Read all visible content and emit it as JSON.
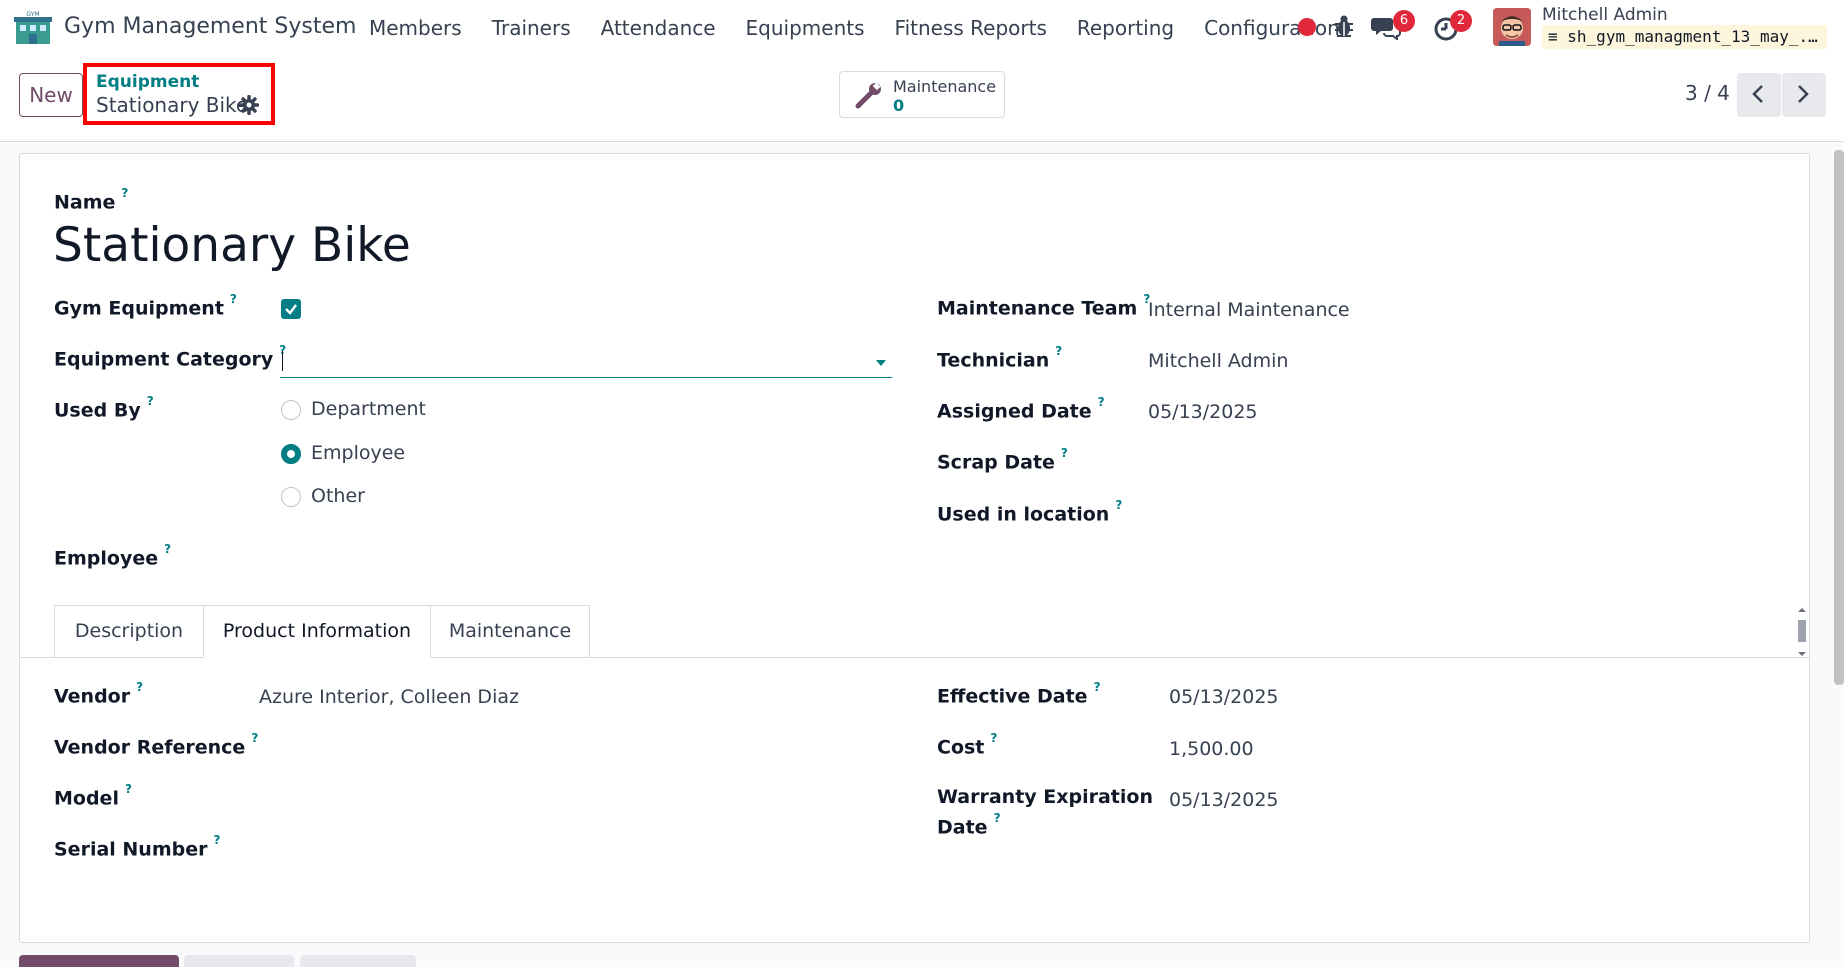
{
  "navbar": {
    "app_name": "Gym Management System",
    "menu": [
      "Members",
      "Trainers",
      "Attendance",
      "Equipments",
      "Fitness Reports",
      "Reporting",
      "Configuration"
    ],
    "messages_count": "6",
    "activities_count": "2",
    "user_name": "Mitchell Admin",
    "database": "sh_gym_managment_13_may_..."
  },
  "control": {
    "new_label": "New",
    "breadcrumb_parent": "Equipment",
    "breadcrumb_current": "Stationary Bike",
    "smart_button_label": "Maintenance",
    "smart_button_value": "0",
    "pager": "3 / 4"
  },
  "form": {
    "name_label": "Name",
    "name_value": "Stationary Bike",
    "left": {
      "gym_equipment_label": "Gym Equipment",
      "gym_equipment_checked": true,
      "category_label": "Equipment Category",
      "category_value": "",
      "used_by_label": "Used By",
      "used_by_options": [
        "Department",
        "Employee",
        "Other"
      ],
      "used_by_selected": "Employee",
      "employee_label": "Employee",
      "employee_value": ""
    },
    "right": {
      "maintenance_team_label": "Maintenance Team",
      "maintenance_team_value": "Internal Maintenance",
      "technician_label": "Technician",
      "technician_value": "Mitchell Admin",
      "assigned_date_label": "Assigned Date",
      "assigned_date_value": "05/13/2025",
      "scrap_date_label": "Scrap Date",
      "scrap_date_value": "",
      "location_label": "Used in location",
      "location_value": ""
    }
  },
  "tabs": {
    "items": [
      "Description",
      "Product Information",
      "Maintenance"
    ],
    "active": "Product Information"
  },
  "product_info": {
    "vendor_label": "Vendor",
    "vendor_value": "Azure Interior, Colleen Diaz",
    "vendor_ref_label": "Vendor Reference",
    "model_label": "Model",
    "serial_label": "Serial Number",
    "effective_date_label": "Effective Date",
    "effective_date_value": "05/13/2025",
    "cost_label": "Cost",
    "cost_value": "1,500.00",
    "warranty_label_line1": "Warranty Expiration",
    "warranty_label_line2": "Date",
    "warranty_value": "05/13/2025"
  },
  "help_marker": "?",
  "colors": {
    "primary": "#714b67",
    "accent": "#017e84",
    "badge": "#e0283a",
    "highlight": "#ff0000"
  }
}
